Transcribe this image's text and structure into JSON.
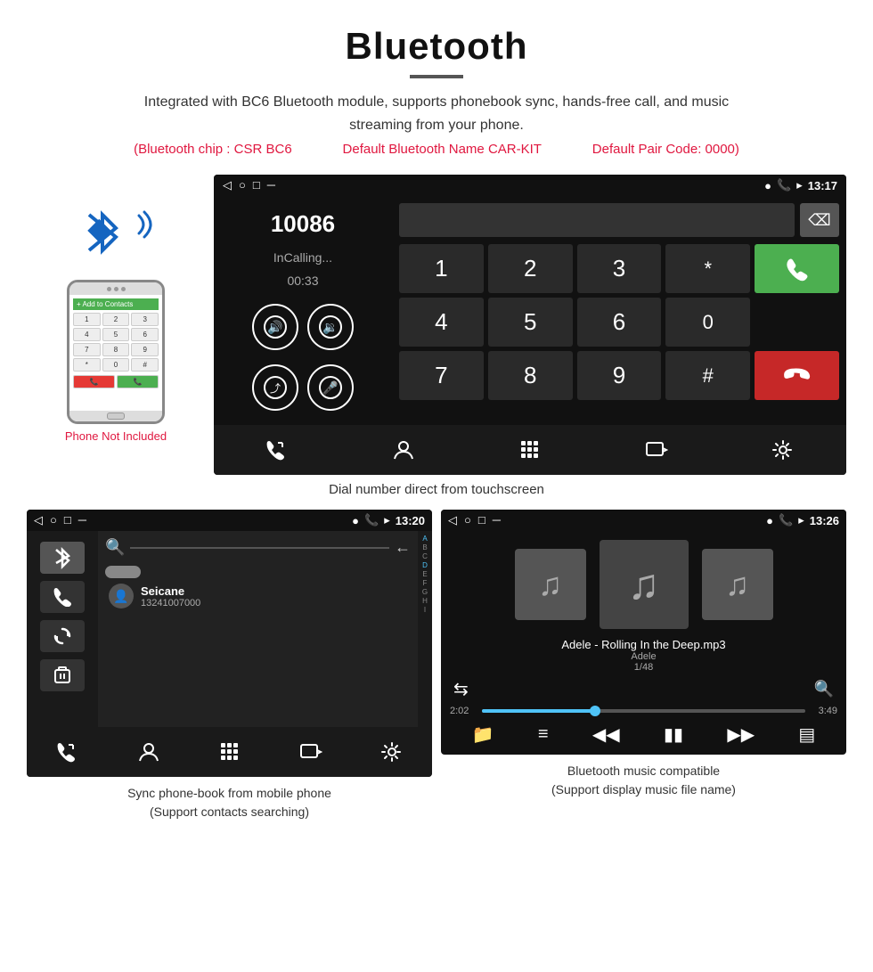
{
  "header": {
    "title": "Bluetooth",
    "description": "Integrated with BC6 Bluetooth module, supports phonebook sync, hands-free call, and music streaming from your phone.",
    "chip_info": "(Bluetooth chip : CSR BC6",
    "default_name": "Default Bluetooth Name CAR-KIT",
    "pair_code": "Default Pair Code: 0000)"
  },
  "dial_screen": {
    "status_time": "13:17",
    "phone_number": "10086",
    "call_status": "InCalling...",
    "call_duration": "00:33",
    "keys": [
      "1",
      "2",
      "3",
      "*",
      "4",
      "5",
      "6",
      "0",
      "7",
      "8",
      "9",
      "#"
    ],
    "caption": "Dial number direct from touchscreen"
  },
  "phonebook_screen": {
    "status_time": "13:20",
    "contact_name": "Seicane",
    "contact_phone": "13241007000",
    "alphabet": [
      "A",
      "B",
      "C",
      "D",
      "E",
      "F",
      "G",
      "H",
      "I"
    ],
    "caption": "Sync phone-book from mobile phone\n(Support contacts searching)"
  },
  "music_screen": {
    "status_time": "13:26",
    "song_title": "Adele - Rolling In the Deep.mp3",
    "artist": "Adele",
    "track_count": "1/48",
    "time_current": "2:02",
    "time_total": "3:49",
    "progress_percent": 35,
    "caption": "Bluetooth music compatible\n(Support display music file name)"
  },
  "phone": {
    "not_included": "Phone Not Included",
    "screen_title": "+ Add to Contacts",
    "keypad": [
      [
        "1",
        "2",
        "3"
      ],
      [
        "4",
        "5",
        "6"
      ],
      [
        "7",
        "8",
        "9"
      ],
      [
        "*",
        "0",
        "#"
      ]
    ]
  }
}
